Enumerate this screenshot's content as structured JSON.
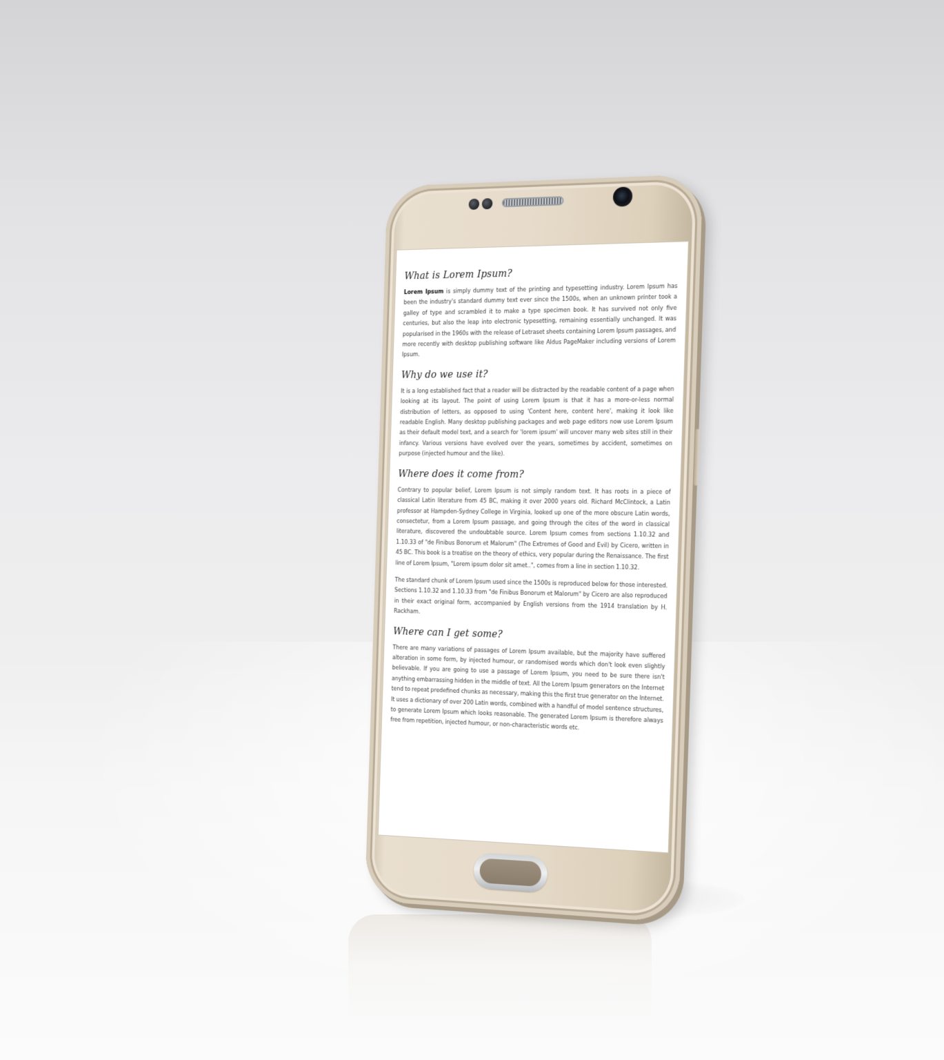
{
  "article": {
    "h1": "What is Lorem Ipsum?",
    "p1_lead": "Lorem Ipsum",
    "p1_rest": " is simply dummy text of the printing and typesetting industry. Lorem Ipsum has been the industry's standard dummy text ever since the 1500s, when an unknown printer took a galley of type and scrambled it to make a type specimen book. It has survived not only five centuries, but also the leap into electronic typesetting, remaining essentially unchanged. It was popularised in the 1960s with the release of Letraset sheets containing Lorem Ipsum passages, and more recently with desktop publishing software like Aldus PageMaker including versions of Lorem Ipsum.",
    "h2": "Why do we use it?",
    "p2": "It is a long established fact that a reader will be distracted by the readable content of a page when looking at its layout. The point of using Lorem Ipsum is that it has a more-or-less normal distribution of letters, as opposed to using 'Content here, content here', making it look like readable English. Many desktop publishing packages and web page editors now use Lorem Ipsum as their default model text, and a search for 'lorem ipsum' will uncover many web sites still in their infancy. Various versions have evolved over the years, sometimes by accident, sometimes on purpose (injected humour and the like).",
    "h3": "Where does it come from?",
    "p3": "Contrary to popular belief, Lorem Ipsum is not simply random text. It has roots in a piece of classical Latin literature from 45 BC, making it over 2000 years old. Richard McClintock, a Latin professor at Hampden-Sydney College in Virginia, looked up one of the more obscure Latin words, consectetur, from a Lorem Ipsum passage, and going through the cites of the word in classical literature, discovered the undoubtable source. Lorem Ipsum comes from sections 1.10.32 and 1.10.33 of \"de Finibus Bonorum et Malorum\" (The Extremes of Good and Evil) by Cicero, written in 45 BC. This book is a treatise on the theory of ethics, very popular during the Renaissance. The first line of Lorem Ipsum, \"Lorem ipsum dolor sit amet..\", comes from a line in section 1.10.32.",
    "p4": "The standard chunk of Lorem Ipsum used since the 1500s is reproduced below for those interested. Sections 1.10.32 and 1.10.33 from \"de Finibus Bonorum et Malorum\" by Cicero are also reproduced in their exact original form, accompanied by English versions from the 1914 translation by H. Rackham.",
    "h4": "Where can I get some?",
    "p5": "There are many variations of passages of Lorem Ipsum available, but the majority have suffered alteration in some form, by injected humour, or randomised words which don't look even slightly believable. If you are going to use a passage of Lorem Ipsum, you need to be sure there isn't anything embarrassing hidden in the middle of text. All the Lorem Ipsum generators on the Internet tend to repeat predefined chunks as necessary, making this the first true generator on the Internet. It uses a dictionary of over 200 Latin words, combined with a handful of model sentence structures, to generate Lorem Ipsum which looks reasonable. The generated Lorem Ipsum is therefore always free from repetition, injected humour, or non-characteristic words etc."
  },
  "colors": {
    "phone_body": "#e7dccb",
    "screen_bg": "#ffffff",
    "text": "#3c3c3c",
    "background": "#ececee"
  },
  "icons": [
    "speaker-grille-icon",
    "front-camera-icon",
    "proximity-sensor-icon",
    "home-button-icon"
  ]
}
